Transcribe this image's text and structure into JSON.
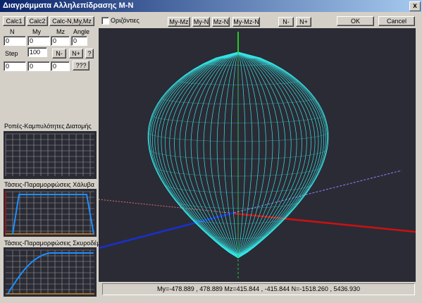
{
  "window": {
    "title": "Διαγράμματα Αλληλεπίδρασης Μ-Ν",
    "close_label": "x"
  },
  "top": {
    "calc1": "Calc1",
    "calc2": "Calc2",
    "calcn": "Calc-N,My,Mz",
    "horizontal_label": "Οριζόντιες",
    "horizontal_checked": false,
    "mymz": "My-Mz",
    "myn": "My-N",
    "mzn": "Mz-N",
    "mymzn": "My-Mz-N",
    "nminus": "N-",
    "nplus": "N+",
    "ok": "OK",
    "cancel": "Cancel"
  },
  "inputs": {
    "n_label": "N",
    "my_label": "My",
    "mz_label": "Mz",
    "angle_label": "Angle",
    "n": "0",
    "my": "0",
    "mz": "0",
    "angle": "0",
    "step_label": "Step",
    "step": "100",
    "nminus": "N-",
    "nplus": "N+",
    "help": "?",
    "r1": "0",
    "r2": "0",
    "r3": "0",
    "more": "???"
  },
  "panels": {
    "p1": "Ροπές-Καμπυλότητες Διατομής",
    "p2": "Τάσεις-Παραμορφώσεις Χάλυβα",
    "p3": "Τάσεις-Παραμορφώσεις Σκυροδέμ."
  },
  "colors": {
    "surface": "#35e6e6",
    "axis_n": "#22cc22",
    "axis_my": "#cc1111",
    "axis_mz": "#1a2fd0",
    "curve": "#1e8fff"
  },
  "status": "My=-478.889 , 478.889 Mz=415.844 , -415.844 N=-1518.260 , 5436.930"
}
